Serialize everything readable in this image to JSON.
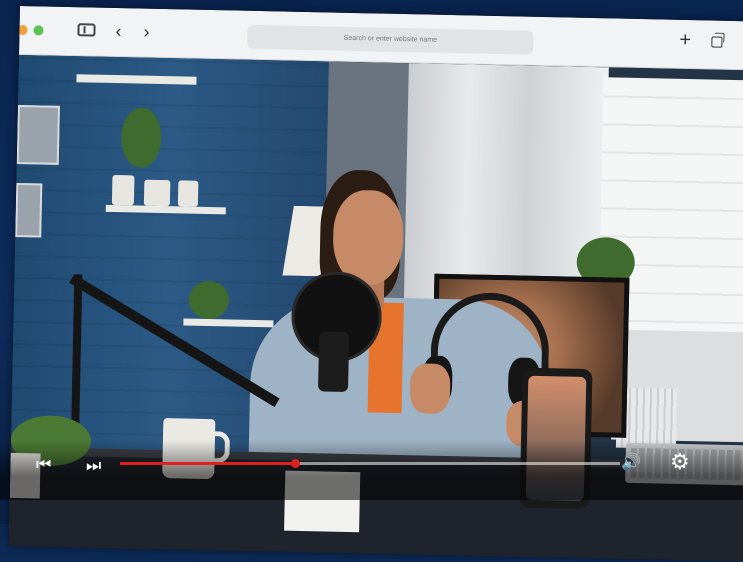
{
  "browser": {
    "address_placeholder": "Search or enter website name",
    "icons": {
      "window_dots": [
        "close-dot",
        "minimize-dot",
        "zoom-dot"
      ],
      "sidebar": "sidebar-icon",
      "back": "chevron-left-icon",
      "forward": "chevron-right-icon",
      "new_tab": "plus-icon",
      "tabs": "tabs-icon"
    },
    "glyphs": {
      "back": "‹",
      "forward": "›",
      "plus": "+"
    }
  },
  "player": {
    "progress_fraction": 0.35,
    "icons": {
      "previous": "skip-previous-icon",
      "next": "skip-next-icon",
      "volume": "volume-icon",
      "settings": "gear-icon"
    },
    "glyphs": {
      "previous": "⏮",
      "next": "⏭",
      "volume": "🔊",
      "settings": "⚙"
    }
  },
  "colors": {
    "progress_accent": "#e02020",
    "dot_orange": "#f0a03a",
    "dot_green": "#5bc24f",
    "background": "#0d2a57"
  }
}
